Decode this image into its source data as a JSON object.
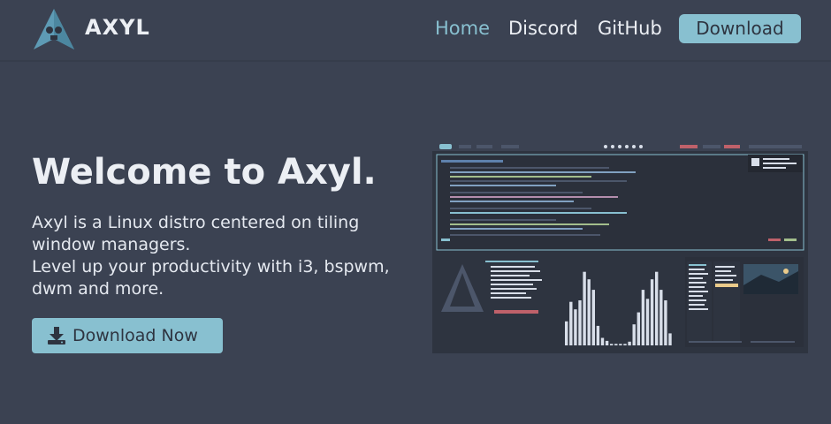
{
  "nav": {
    "brand": "AXYL",
    "links": [
      {
        "label": "Home",
        "active": true
      },
      {
        "label": "Discord",
        "active": false
      },
      {
        "label": "GitHub",
        "active": false
      }
    ],
    "download_label": "Download"
  },
  "hero": {
    "title": "Welcome to Axyl.",
    "description_lines": [
      "Axyl is a Linux distro centered on tiling",
      "window managers.",
      "Level up your productivity with i3, bspwm,",
      "dwm and more."
    ],
    "cta_label": "Download Now",
    "cta_icon": "download-icon"
  },
  "screenshot": {
    "alt": "desktop-screenshot",
    "bar_heights": [
      0.32,
      0.58,
      0.48,
      0.6,
      0.98,
      0.88,
      0.74,
      0.26,
      0.1,
      0.06,
      0.02,
      0.02,
      0.02,
      0.02,
      0.05,
      0.28,
      0.44,
      0.74,
      0.62,
      0.88,
      0.98,
      0.74,
      0.6,
      0.16
    ]
  },
  "colors": {
    "background": "#3b4252",
    "accent": "#88c0d0",
    "text": "#eceff4",
    "button_text": "#2e3440"
  }
}
